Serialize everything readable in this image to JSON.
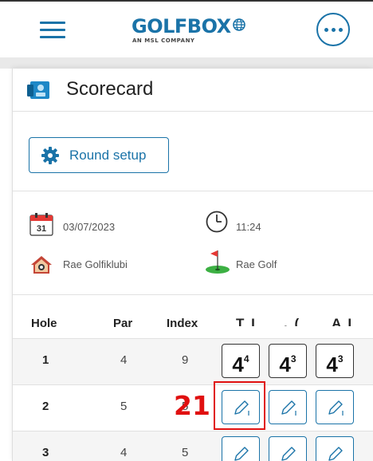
{
  "header": {
    "menu_icon": "hamburger-menu-icon",
    "logo_text": "GOLFBOX",
    "logo_subtitle": "AN MSL COMPANY",
    "more_icon": "more-options-icon",
    "brand_color": "#1a73a8"
  },
  "page": {
    "title": "Scorecard",
    "title_icon": "scorecard-icon"
  },
  "setup": {
    "button_label": "Round setup",
    "button_icon": "gear-icon"
  },
  "info": {
    "date": "03/07/2023",
    "date_icon": "calendar-icon",
    "time": "11:24",
    "time_icon": "clock-icon",
    "club": "Rae Golfiklubi",
    "club_icon": "clubhouse-icon",
    "course": "Rae Golf",
    "course_icon": "golf-flag-icon"
  },
  "table": {
    "columns": [
      "Hole",
      "Par",
      "Index"
    ],
    "player_columns": [
      "T I",
      ". (",
      "A I"
    ],
    "rows": [
      {
        "hole": "1",
        "par": "4",
        "index": "9",
        "scores": [
          {
            "value": "4",
            "sup": "4"
          },
          {
            "value": "4",
            "sup": "3"
          },
          {
            "value": "4",
            "sup": "3"
          }
        ]
      },
      {
        "hole": "2",
        "par": "5",
        "index": "5",
        "scores": []
      },
      {
        "hole": "3",
        "par": "4",
        "index": "5",
        "scores": []
      }
    ]
  },
  "annotation": {
    "label": "21",
    "color": "#e01010"
  }
}
